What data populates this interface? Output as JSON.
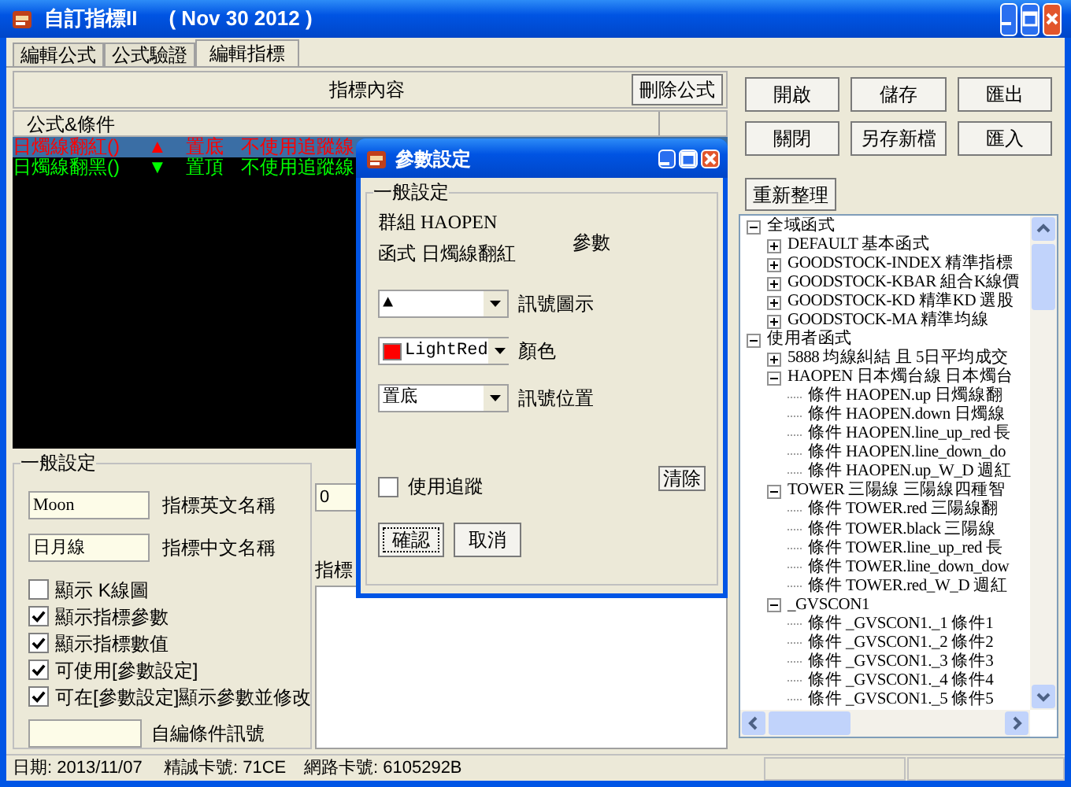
{
  "window": {
    "title": "自訂指標II",
    "subtitle": "( Nov 30 2012 )"
  },
  "tabs": [
    {
      "label": "編輯公式",
      "selected": false
    },
    {
      "label": "公式驗證",
      "selected": false
    },
    {
      "label": "編輯指標",
      "selected": true
    }
  ],
  "content_header": {
    "title": "指標內容",
    "delete_button": "刪除公式"
  },
  "formula_list": {
    "columns": [
      "公式&條件"
    ],
    "rows": [
      {
        "name": "日燭線翻紅()",
        "signal": "▲",
        "position": "置底",
        "tracking": "不使用追蹤線",
        "color": "#ff0000",
        "selected": true
      },
      {
        "name": "日燭線翻黑()",
        "signal": "▼",
        "position": "置頂",
        "tracking": "不使用追蹤線",
        "color": "#00ff00",
        "selected": false
      }
    ]
  },
  "general_settings": {
    "title": "一般設定",
    "fields": [
      {
        "value": "Moon",
        "label": "指標英文名稱"
      },
      {
        "value": "日月線",
        "label": "指標中文名稱"
      }
    ],
    "options": [
      {
        "label": "顯示 K線圖",
        "checked": false
      },
      {
        "label": "顯示指標參數",
        "checked": true
      },
      {
        "label": "顯示指標數值",
        "checked": true
      },
      {
        "label": "可使用[參數設定]",
        "checked": true
      },
      {
        "label": "可在[參數設定]顯示參數並修改",
        "checked": true
      }
    ],
    "custom_signal": {
      "label": "自編條件訊號"
    }
  },
  "param_field": {
    "value": "0"
  },
  "description": {
    "label": "指標"
  },
  "action_buttons": [
    [
      "開啟",
      "儲存",
      "匯出"
    ],
    [
      "關閉",
      "另存新檔",
      "匯入"
    ]
  ],
  "refresh_button": "重新整理",
  "tree": [
    {
      "label": "全域函式",
      "expanded": true,
      "children": [
        {
          "label": "DEFAULT 基本函式",
          "expanded": false
        },
        {
          "label": "GOODSTOCK-INDEX 精準指標",
          "expanded": false
        },
        {
          "label": "GOODSTOCK-KBAR 組合K線價",
          "expanded": false
        },
        {
          "label": "GOODSTOCK-KD 精準KD  選股",
          "expanded": false
        },
        {
          "label": "GOODSTOCK-MA 精準均線",
          "expanded": false
        }
      ]
    },
    {
      "label": "使用者函式",
      "expanded": true,
      "children": [
        {
          "label": "5888 均線糾結 且 5日平均成交",
          "expanded": false
        },
        {
          "label": "HAOPEN 日本燭台線 日本燭台",
          "expanded": true,
          "children": [
            {
              "label": "條件 HAOPEN.up 日燭線翻"
            },
            {
              "label": "條件 HAOPEN.down 日燭線"
            },
            {
              "label": "條件 HAOPEN.line_up_red 長"
            },
            {
              "label": "條件 HAOPEN.line_down_do"
            },
            {
              "label": "條件 HAOPEN.up_W_D 週紅"
            }
          ]
        },
        {
          "label": "TOWER 三陽線 三陽線四種智",
          "expanded": true,
          "children": [
            {
              "label": "條件 TOWER.red 三陽線翻"
            },
            {
              "label": "條件 TOWER.black 三陽線"
            },
            {
              "label": "條件 TOWER.line_up_red 長"
            },
            {
              "label": "條件 TOWER.line_down_dow"
            },
            {
              "label": "條件 TOWER.red_W_D 週紅"
            }
          ]
        },
        {
          "label": "_GVSCON1",
          "expanded": true,
          "children": [
            {
              "label": "條件 _GVSCON1._1 條件1"
            },
            {
              "label": "條件 _GVSCON1._2 條件2"
            },
            {
              "label": "條件 _GVSCON1._3 條件3"
            },
            {
              "label": "條件 _GVSCON1._4 條件4"
            },
            {
              "label": "條件 _GVSCON1._5 條件5"
            }
          ]
        }
      ]
    }
  ],
  "dialog": {
    "title": "參數設定",
    "group_title": "一般設定",
    "group_line": "群組 HAOPEN",
    "function_line": "函式 日燭線翻紅",
    "params_label": "參數",
    "dropdowns": [
      {
        "value": "▲",
        "label": "訊號圖示"
      },
      {
        "value": "LightRed",
        "label": "顏色",
        "color": "#ff0000"
      },
      {
        "value": "置底",
        "label": "訊號位置"
      }
    ],
    "clear_button": "清除",
    "tracking": {
      "label": "使用追蹤",
      "checked": false
    },
    "ok_button": "確認",
    "cancel_button": "取消"
  },
  "status_bar": [
    "日期: 2013/11/07",
    "精誠卡號: 71CE",
    "網路卡號: 6105292B"
  ]
}
